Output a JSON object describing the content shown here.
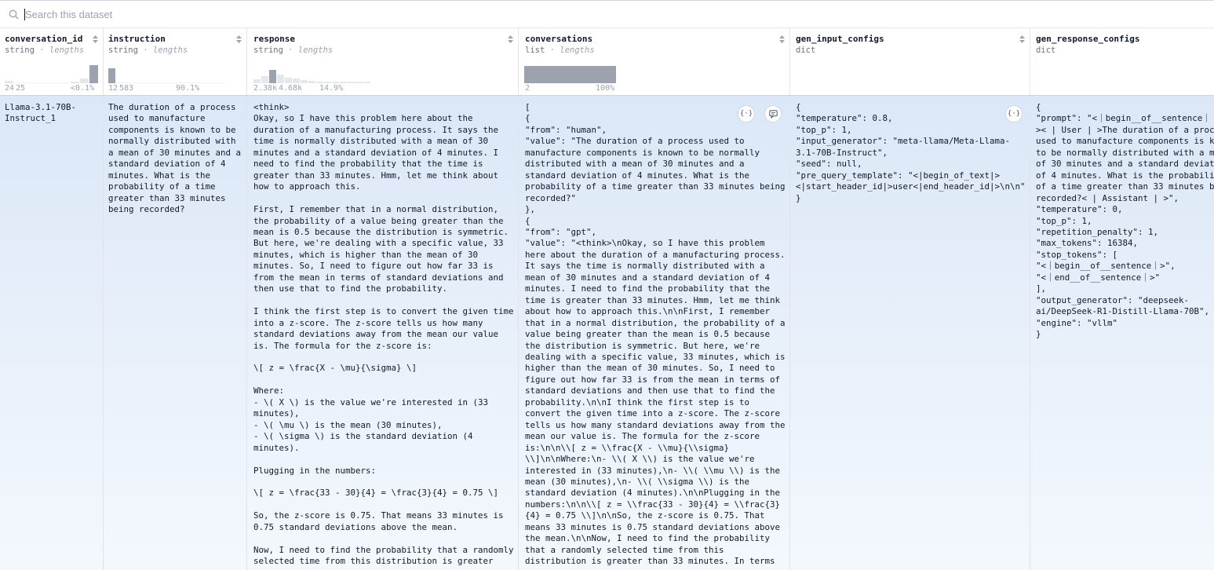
{
  "search": {
    "placeholder": "Search this dataset"
  },
  "columns": [
    {
      "name": "conversation_id",
      "type": "string",
      "sep": " · ",
      "stat": "lengths",
      "range_min": "24",
      "range_mid": "25",
      "range_max": "<0.1%"
    },
    {
      "name": "instruction",
      "type": "string",
      "sep": " · ",
      "stat": "lengths",
      "range_min": "12",
      "range_mid": "583",
      "range_max": "90.1%"
    },
    {
      "name": "response",
      "type": "string",
      "sep": " · ",
      "stat": "lengths",
      "range_min": "2.38k",
      "range_mid": "4.68k",
      "range_max": "14.9%"
    },
    {
      "name": "conversations",
      "type": "list",
      "sep": " · ",
      "stat": "lengths",
      "range_min": "2",
      "range_max": "100%"
    },
    {
      "name": "gen_input_configs",
      "type": "dict"
    },
    {
      "name": "gen_response_configs",
      "type": "dict"
    }
  ],
  "histograms": {
    "conversation_id": [
      0.12,
      0,
      0,
      0,
      0,
      0,
      0,
      0.06,
      0.22,
      0.9
    ],
    "instruction": [
      0.85,
      0,
      0,
      0,
      0,
      0,
      0,
      0,
      0,
      0,
      0,
      0,
      0,
      0,
      0
    ],
    "response": [
      0.25,
      0.45,
      0.85,
      0.55,
      0.35,
      0.3,
      0.2,
      0.15,
      0.1,
      0.06,
      0.04,
      0.03,
      0.02,
      0.01,
      0.01
    ],
    "conversations": [
      1.0
    ]
  },
  "row": {
    "conversation_id": "Llama-3.1-70B-\nInstruct_1",
    "instruction": "The duration of a process\nused to manufacture\ncomponents is known to be\nnormally distributed with\na mean of 30 minutes and a\nstandard deviation of 4\nminutes. What is the\nprobability of a time\ngreater than 33 minutes\nbeing recorded?",
    "response": "<think>\nOkay, so I have this problem here about the\nduration of a manufacturing process. It says the\ntime is normally distributed with a mean of 30\nminutes and a standard deviation of 4 minutes. I\nneed to find the probability that the time is\ngreater than 33 minutes. Hmm, let me think about\nhow to approach this.\n\nFirst, I remember that in a normal distribution,\nthe probability of a value being greater than the\nmean is 0.5 because the distribution is symmetric.\nBut here, we're dealing with a specific value, 33\nminutes, which is higher than the mean of 30\nminutes. So, I need to figure out how far 33 is\nfrom the mean in terms of standard deviations and\nthen use that to find the probability.\n\nI think the first step is to convert the given time\ninto a z-score. The z-score tells us how many\nstandard deviations away from the mean our value\nis. The formula for the z-score is:\n\n\\[ z = \\frac{X - \\mu}{\\sigma} \\]\n\nWhere:\n- \\( X \\) is the value we're interested in (33\nminutes),\n- \\( \\mu \\) is the mean (30 minutes),\n- \\( \\sigma \\) is the standard deviation (4\nminutes).\n\nPlugging in the numbers:\n\n\\[ z = \\frac{33 - 30}{4} = \\frac{3}{4} = 0.75 \\]\n\nSo, the z-score is 0.75. That means 33 minutes is\n0.75 standard deviations above the mean.\n\nNow, I need to find the probability that a randomly\nselected time from this distribution is greater",
    "conversations": "[\n{\n\"from\": \"human\",\n\"value\": \"The duration of a process used to\nmanufacture components is known to be normally\ndistributed with a mean of 30 minutes and a\nstandard deviation of 4 minutes. What is the\nprobability of a time greater than 33 minutes being\nrecorded?\"\n},\n{\n\"from\": \"gpt\",\n\"value\": \"<think>\\nOkay, so I have this problem\nhere about the duration of a manufacturing process.\nIt says the time is normally distributed with a\nmean of 30 minutes and a standard deviation of 4\nminutes. I need to find the probability that the\ntime is greater than 33 minutes. Hmm, let me think\nabout how to approach this.\\n\\nFirst, I remember\nthat in a normal distribution, the probability of a\nvalue being greater than the mean is 0.5 because\nthe distribution is symmetric. But here, we're\ndealing with a specific value, 33 minutes, which is\nhigher than the mean of 30 minutes. So, I need to\nfigure out how far 33 is from the mean in terms of\nstandard deviations and then use that to find the\nprobability.\\n\\nI think the first step is to\nconvert the given time into a z-score. The z-score\ntells us how many standard deviations away from the\nmean our value is. The formula for the z-score\nis:\\n\\n\\\\[ z = \\\\frac{X - \\\\mu}{\\\\sigma}\n\\\\]\\n\\nWhere:\\n- \\\\( X \\\\) is the value we're\ninterested in (33 minutes),\\n- \\\\( \\\\mu \\\\) is the\nmean (30 minutes),\\n- \\\\( \\\\sigma \\\\) is the\nstandard deviation (4 minutes).\\n\\nPlugging in the\nnumbers:\\n\\n\\\\[ z = \\\\frac{33 - 30}{4} = \\\\frac{3}\n{4} = 0.75 \\\\]\\n\\nSo, the z-score is 0.75. That\nmeans 33 minutes is 0.75 standard deviations above\nthe mean.\\n\\nNow, I need to find the probability\nthat a randomly selected time from this\ndistribution is greater than 33 minutes. In terms",
    "gen_input_configs": "{\n\"temperature\": 0.8,\n\"top_p\": 1,\n\"input_generator\": \"meta-llama/Meta-Llama-\n3.1-70B-Instruct\",\n\"seed\": null,\n\"pre_query_template\": \"<|begin_of_text|>\n<|start_header_id|>user<|end_header_id|>\\n\\n\"\n}",
    "gen_response_configs": "{\n\"prompt\": \"<｜begin__of__sentence｜\n>< | User | >The duration of a process\nused to manufacture components is k\nto be normally distributed with a m\nof 30 minutes and a standard deviat\nof 4 minutes. What is the probabili\nof a time greater than 33 minutes b\nrecorded?< | Assistant | >\",\n\"temperature\": 0,\n\"top_p\": 1,\n\"repetition_penalty\": 1,\n\"max_tokens\": 16384,\n\"stop_tokens\": [\n\"<｜begin__of__sentence｜>\",\n\"<｜end__of__sentence｜>\"\n],\n\"output_generator\": \"deepseek-\nai/DeepSeek-R1-Distill-Llama-70B\",\n\"engine\": \"vllm\"\n}"
  },
  "buttons": {
    "json_label": "{·}"
  },
  "colors": {
    "row_bg": "#dbe7f7",
    "hist_selected": "#9ca3af",
    "hist_other": "#e5e7eb"
  }
}
